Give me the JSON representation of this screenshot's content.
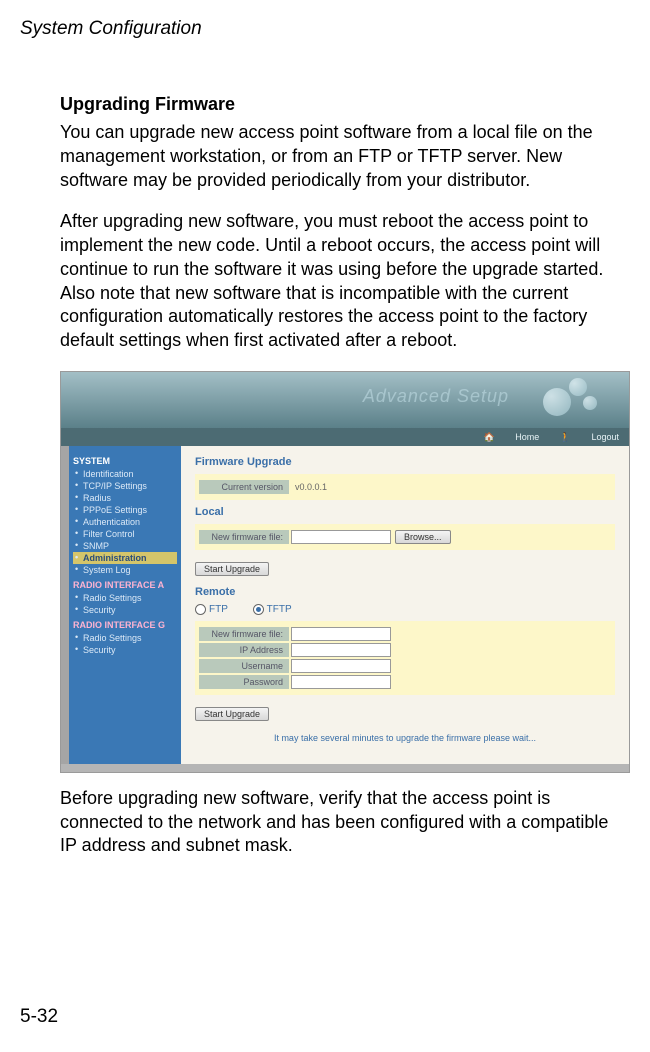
{
  "running_head": "System Configuration",
  "page_num": "5-32",
  "section_title": "Upgrading Firmware",
  "para1": "You can upgrade new access point software from a local file on the management workstation, or from an FTP or TFTP server. New software may be provided periodically from your distributor.",
  "para2": "After upgrading new software, you must reboot the access point to implement the new code. Until a reboot occurs, the access point will continue to run the software it was using before the upgrade started. Also note that new software that is incompatible with the current configuration automatically restores the access point to the factory default settings when first activated after a reboot.",
  "para3": "Before upgrading new software, verify that the access point is connected to the network and has been configured with a compatible IP address and subnet mask.",
  "shot": {
    "advanced_title": "Advanced Setup",
    "toolbar": {
      "home": "Home",
      "logout": "Logout"
    },
    "sidebar": {
      "system_label": "SYSTEM",
      "system_items": [
        "Identification",
        "TCP/IP Settings",
        "Radius",
        "PPPoE Settings",
        "Authentication",
        "Filter Control",
        "SNMP",
        "Administration",
        "System Log"
      ],
      "radio_a_label": "RADIO INTERFACE A",
      "radio_a_items": [
        "Radio Settings",
        "Security"
      ],
      "radio_g_label": "RADIO INTERFACE G",
      "radio_g_items": [
        "Radio Settings",
        "Security"
      ]
    },
    "content": {
      "header_firmware": "Firmware Upgrade",
      "current_version_label": "Current version",
      "current_version_value": "v0.0.0.1",
      "header_local": "Local",
      "new_firmware_label": "New firmware file:",
      "browse_label": "Browse...",
      "start_upgrade_label": "Start Upgrade",
      "header_remote": "Remote",
      "ftp_label": "FTP",
      "tftp_label": "TFTP",
      "remote_firmware_label": "New firmware file:",
      "ip_label": "IP Address",
      "user_label": "Username",
      "pass_label": "Password",
      "wait_msg": "It may take several minutes to upgrade the firmware please wait..."
    }
  }
}
